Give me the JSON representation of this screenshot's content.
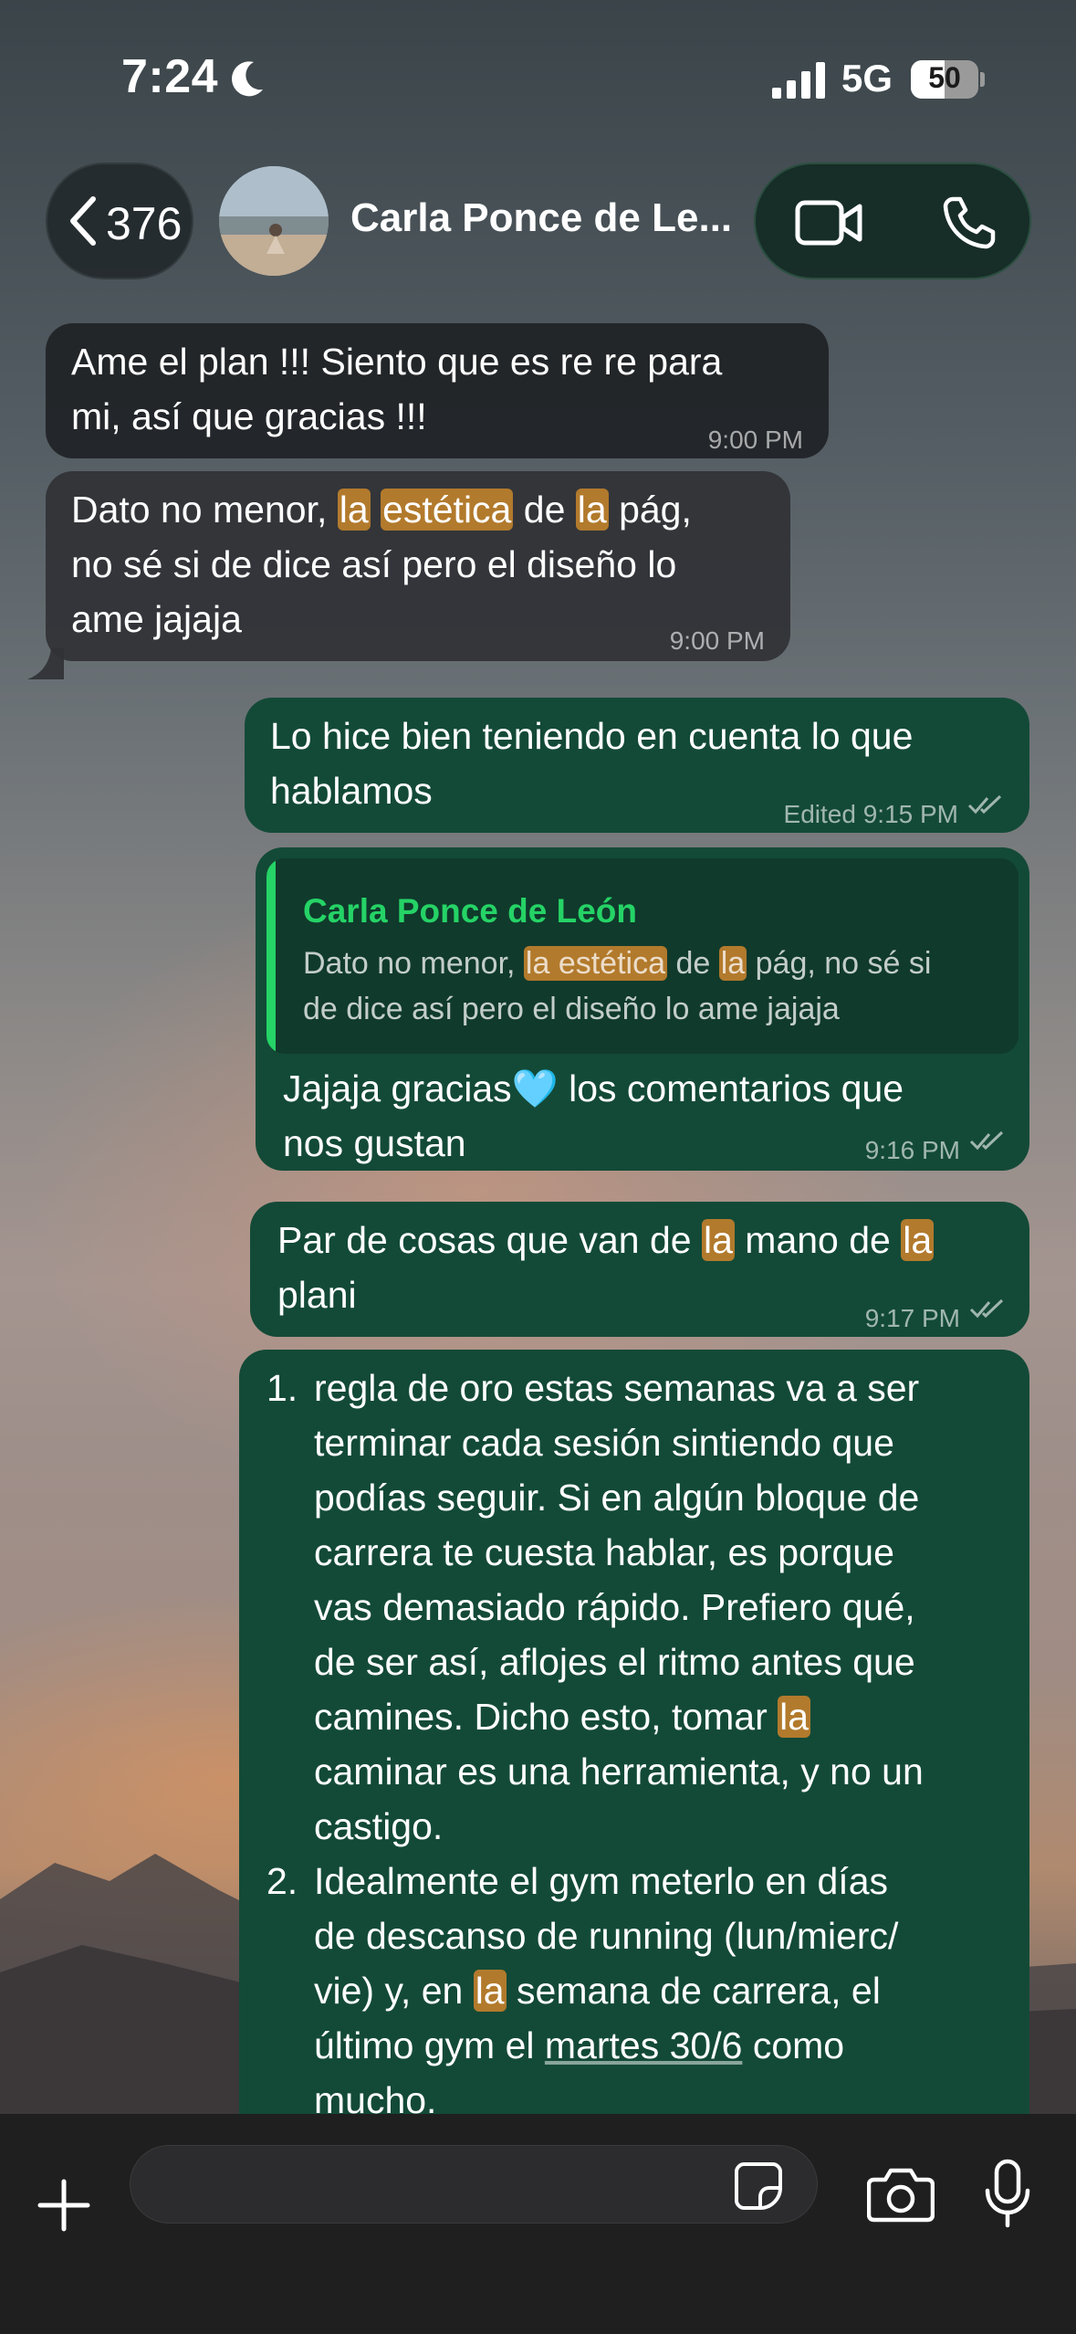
{
  "status_bar": {
    "time": "7:24",
    "network": "5G",
    "battery_level": "50",
    "battery_fraction": 0.5
  },
  "header": {
    "back_count": "376",
    "contact_name": "Carla Ponce de Le...",
    "icons": [
      "chevron-left-icon",
      "video-call-icon",
      "phone-icon"
    ]
  },
  "messages": [
    {
      "direction": "in",
      "lines": [
        "Ame el plan !!! Siento que es re re para",
        "mi, así que gracias !!!"
      ],
      "time": "9:00 PM"
    },
    {
      "direction": "in",
      "line1_a": "Dato no menor, ",
      "line1_hl1": "la",
      "line1_hl2": "estética",
      "line1_b": " de ",
      "line1_hl3": "la",
      "line1_c": " pág,",
      "lines": [
        "no sé si de dice así pero el diseño lo",
        "ame jajaja"
      ],
      "time": "9:00 PM"
    },
    {
      "direction": "out",
      "lines": [
        "Lo hice bien teniendo en cuenta lo que",
        "hablamos"
      ],
      "time": "Edited 9:15 PM"
    },
    {
      "direction": "out",
      "quote": {
        "author": "Carla Ponce de León",
        "line1_a": "Dato no menor, ",
        "line1_hl1": "la estética",
        "line1_b": " de ",
        "line1_hl2": "la",
        "line1_c": " pág, no sé si",
        "line2": "de dice así pero el diseño lo ame jajaja"
      },
      "line1": "Jajaja gracias🩵 los comentarios que",
      "line2": "nos gustan",
      "time": "9:16 PM"
    },
    {
      "direction": "out",
      "line1_a": "Par de cosas que van de ",
      "line1_hl1": "la",
      "line1_b": " mano de ",
      "line1_hl2": "la",
      "line2": "plani",
      "time": "9:17 PM"
    },
    {
      "direction": "out",
      "items": [
        {
          "num": "1.",
          "lines": [
            "regla de oro estas semanas va a ser",
            "terminar cada sesión sintiendo que",
            "podías seguir. Si en algún bloque de",
            "carrera te cuesta hablar, es porque",
            "vas demasiado rápido. Prefiero qué,",
            "de ser así, aflojes el ritmo antes que"
          ],
          "line7_a": "camines. Dicho esto, tomar ",
          "line7_hl": "la",
          "line8": "caminar es una herramienta, y no un",
          "line9": "castigo."
        },
        {
          "num": "2.",
          "line1": "Idealmente el gym meterlo en días",
          "line2": "de descanso de running (lun/mierc/",
          "line3_a": "vie) y, en ",
          "line3_hl": "la",
          "line3_b": " semana de carrera, el",
          "line4_a": "último gym el ",
          "line4_link": "martes 30/6",
          "line4_b": " como",
          "line5": "mucho."
        }
      ]
    }
  ],
  "composer": {
    "icons": [
      "plus-icon",
      "sticker-icon",
      "camera-icon",
      "microphone-icon"
    ]
  }
}
